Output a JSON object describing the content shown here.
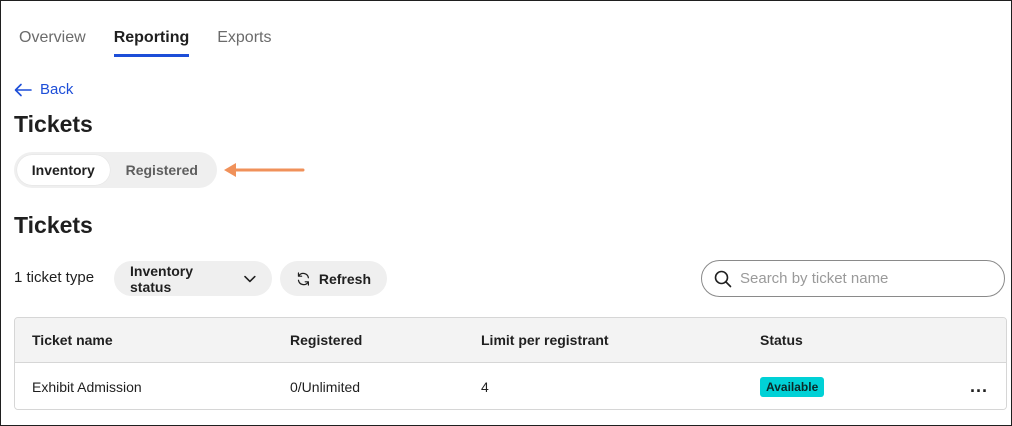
{
  "tabs": [
    {
      "label": "Overview",
      "active": false
    },
    {
      "label": "Reporting",
      "active": true
    },
    {
      "label": "Exports",
      "active": false
    }
  ],
  "back_label": "Back",
  "page_title": "Tickets",
  "toggle": {
    "inventory_label": "Inventory",
    "registered_label": "Registered",
    "selected": "Inventory"
  },
  "section_title": "Tickets",
  "toolbar": {
    "count_text": "1 ticket type",
    "status_filter_label": "Inventory status",
    "refresh_label": "Refresh"
  },
  "search": {
    "placeholder": "Search by ticket name",
    "value": ""
  },
  "table": {
    "columns": [
      "Ticket name",
      "Registered",
      "Limit per registrant",
      "Status"
    ],
    "rows": [
      {
        "name": "Exhibit Admission",
        "registered": "0/Unlimited",
        "limit": "4",
        "status": "Available",
        "more": "..."
      }
    ]
  },
  "colors": {
    "accent": "#1d4ed8",
    "annotation_arrow": "#f0915a",
    "status_available": "#00d1d6"
  },
  "icons": {
    "back": "arrow-left-icon",
    "status_filter": "chevron-down-icon",
    "refresh": "refresh-icon",
    "search": "search-icon",
    "row_menu": "more-horizontal-icon",
    "annotation": "arrow-left-icon"
  }
}
